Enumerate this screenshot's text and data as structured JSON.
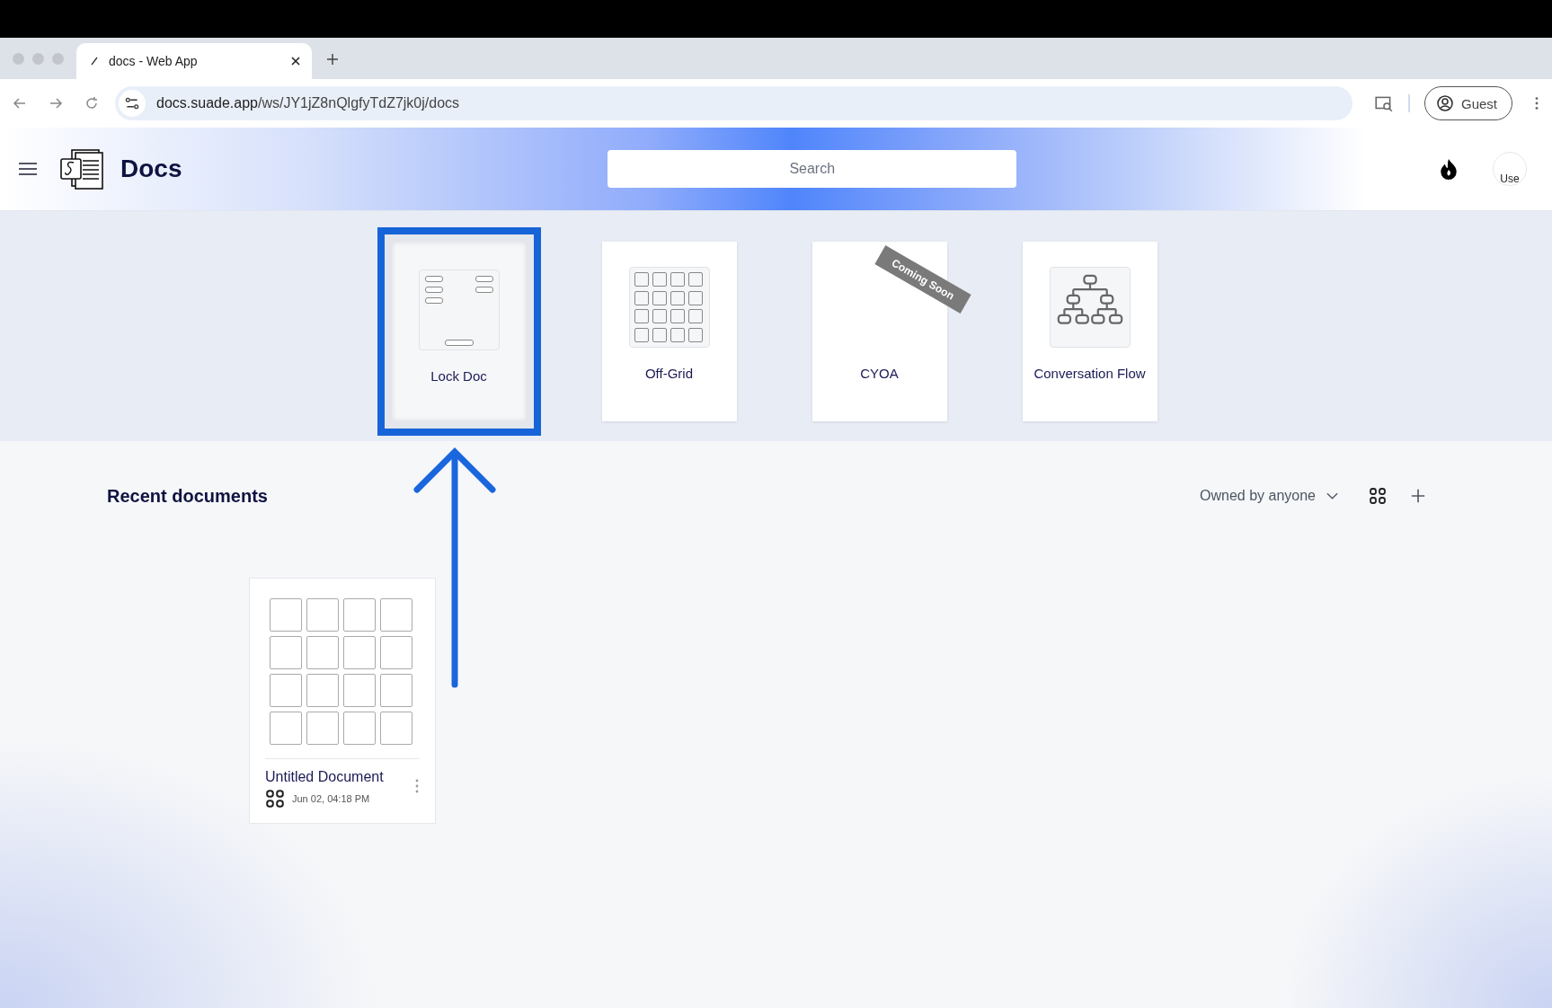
{
  "browser": {
    "tab": {
      "title": "docs - Web App"
    },
    "address": {
      "host": "docs.suade.app",
      "path": "/ws/JY1jZ8nQlgfyTdZ7jk0j/docs"
    },
    "profile": "Guest"
  },
  "header": {
    "title": "Docs",
    "search": {
      "placeholder": "Search"
    },
    "avatar_alt": "Use"
  },
  "templates": [
    {
      "label": "Lock Doc",
      "kind": "form",
      "selected": true
    },
    {
      "label": "Off-Grid",
      "kind": "grid",
      "selected": false
    },
    {
      "label": "CYOA",
      "kind": "blank",
      "selected": false,
      "badge": "Coming Soon"
    },
    {
      "label": "Conversation Flow",
      "kind": "tree",
      "selected": false
    }
  ],
  "recent": {
    "title": "Recent documents",
    "filter": "Owned by anyone",
    "documents": [
      {
        "title": "Untitled Document",
        "date": "Jun 02, 04:18 PM",
        "kind": "grid"
      }
    ]
  }
}
